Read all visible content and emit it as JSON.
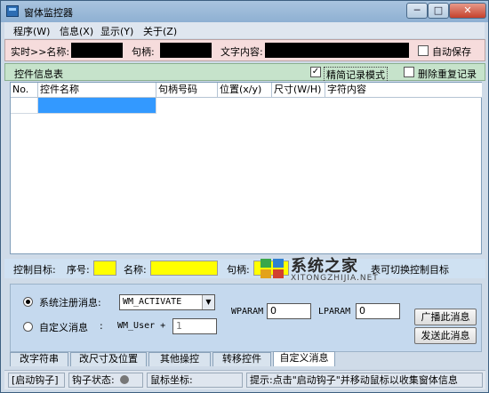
{
  "window": {
    "title": "窗体监控器",
    "min_label": "─",
    "max_label": "□",
    "close_label": "✕"
  },
  "menu": [
    {
      "label": "程序(W)"
    },
    {
      "label": "信息(X)"
    },
    {
      "label": "显示(Y)"
    },
    {
      "label": "关于(Z)"
    }
  ],
  "realtime": {
    "prefix": "实时>>名称:",
    "handle_label": "句柄:",
    "text_label": "文字内容:",
    "autosave_label": "自动保存",
    "autosave_checked": false
  },
  "control_info": {
    "title": "控件信息表",
    "simple_mode_label": "精简记录模式",
    "simple_mode_checked": true,
    "dedupe_label": "删除重复记录",
    "dedupe_checked": false
  },
  "table": {
    "columns": [
      "No.",
      "控件名称",
      "句柄号码",
      "位置(x/y)",
      "尺寸(W/H)",
      "字符内容"
    ]
  },
  "control_target": {
    "label": "控制目标:",
    "index_label": "序号:",
    "name_label": "名称:",
    "handle_label": "句柄:",
    "hint_tail": "表可切换控制目标"
  },
  "message": {
    "system_label": "系统注册消息:",
    "system_value": "WM_ACTIVATE",
    "custom_label": "自定义消息",
    "custom_colon": ":",
    "custom_prefix": "WM_User +",
    "custom_value": "1",
    "wparam_label": "WPARAM",
    "wparam_value": "0",
    "lparam_label": "LPARAM",
    "lparam_value": "0",
    "broadcast_label": "广播此消息",
    "send_label": "发送此消息"
  },
  "tabs": [
    {
      "label": "改字符串"
    },
    {
      "label": "改尺寸及位置"
    },
    {
      "label": "其他操控"
    },
    {
      "label": "转移控件"
    },
    {
      "label": "自定义消息",
      "active": true
    }
  ],
  "status": {
    "hook_button": "[启动钩子]",
    "hook_state_label": "钩子状态:",
    "mouse_label": "鼠标坐标:",
    "hint": "提示:点击\"启动钩子\"并移动鼠标以收集窗体信息"
  },
  "watermark": {
    "text_cn": "系统之家",
    "text_en": "XITONGZHIJIA.NET"
  }
}
